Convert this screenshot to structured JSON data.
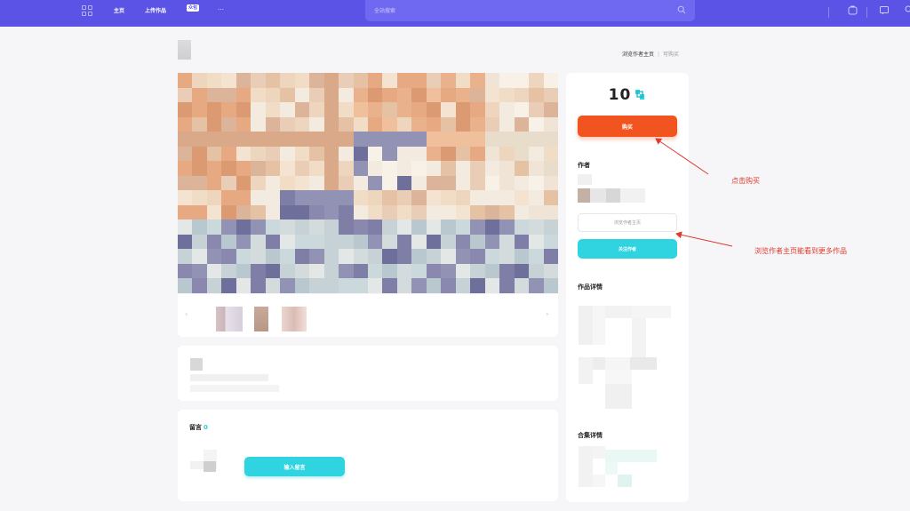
{
  "nav": {
    "items": [
      "主页",
      "上传作品"
    ],
    "badge": "众包",
    "more": "…",
    "search_placeholder": "全站搜索"
  },
  "breadcrumb": {
    "link": "浏览作者主页",
    "muted": "可购买"
  },
  "side": {
    "price": "10",
    "buy_label": "购买",
    "author_heading": "作者",
    "home_label": "浏览作者主页",
    "follow_label": "关注作者",
    "details_heading": "作品详情",
    "collection_heading": "合集详情"
  },
  "comments": {
    "title": "留言",
    "count": "0",
    "button_label": "输入留言"
  },
  "annotations": {
    "buy_hint": "点击购买",
    "home_hint": "浏览作者主页能看到更多作品"
  },
  "colors": {
    "nav_bg": "#5a53e6",
    "buy": "#f2541f",
    "teal": "#2fd4e0",
    "annotation": "#e0392b"
  }
}
